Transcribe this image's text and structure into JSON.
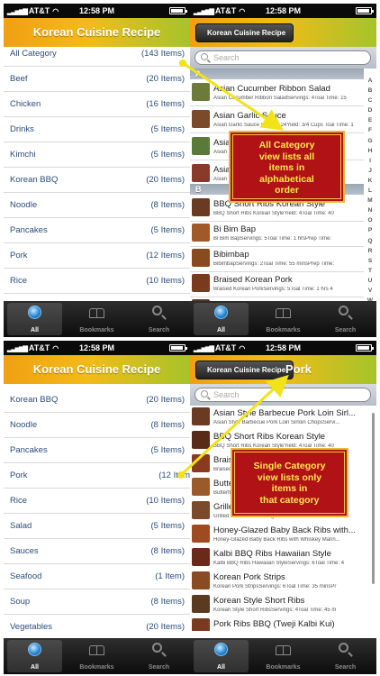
{
  "status": {
    "carrier": "AT&T",
    "time": "12:58 PM"
  },
  "app_title": "Korean Cuisine Recipe",
  "back_label": "Korean Cuisine Recipe",
  "search_placeholder": "Search",
  "tabs": [
    {
      "label": "All",
      "icon": "globe-icon"
    },
    {
      "label": "Bookmarks",
      "icon": "book-icon"
    },
    {
      "label": "Search",
      "icon": "magnifier-icon"
    }
  ],
  "categories_top": [
    {
      "name": "All Category",
      "count": "(143 Items)"
    },
    {
      "name": "Beef",
      "count": "(20 Items)"
    },
    {
      "name": "Chicken",
      "count": "(16 Items)"
    },
    {
      "name": "Drinks",
      "count": "(5 Items)"
    },
    {
      "name": "Kimchi",
      "count": "(5 Items)"
    },
    {
      "name": "Korean BBQ",
      "count": "(20 Items)"
    },
    {
      "name": "Noodle",
      "count": "(8 Items)"
    },
    {
      "name": "Pancakes",
      "count": "(5 Items)"
    },
    {
      "name": "Pork",
      "count": "(12 Items)"
    },
    {
      "name": "Rice",
      "count": "(10 Items)"
    }
  ],
  "categories_bottom": [
    {
      "name": "Korean BBQ",
      "count": "(20 Items)"
    },
    {
      "name": "Noodle",
      "count": "(8 Items)"
    },
    {
      "name": "Pancakes",
      "count": "(5 Items)"
    },
    {
      "name": "Pork",
      "count": "(12 Items)"
    },
    {
      "name": "Rice",
      "count": "(10 Items)"
    },
    {
      "name": "Salad",
      "count": "(5 Items)"
    },
    {
      "name": "Sauces",
      "count": "(8 Items)"
    },
    {
      "name": "Seafood",
      "count": "(1 Item)"
    },
    {
      "name": "Soup",
      "count": "(8 Items)"
    },
    {
      "name": "Vegetables",
      "count": "(20 Items)"
    }
  ],
  "all_recipes": {
    "section_a": "A",
    "section_a_items": [
      {
        "title": "Asian Cucumber Ribbon Salad",
        "sub": "Asian Cucumber Ribbon SaladServings: 4Toal Time: 15",
        "color": "#6d7b3a"
      },
      {
        "title": "Asian Garlic Sauce",
        "sub": "Asian Garlic Sauce Serves: 24Yield: 3/4 Cups Toal Time: 1",
        "color": "#7a4a2a"
      },
      {
        "title": "Asian Cucumber",
        "sub": "Asian",
        "color": "#5a7a3a"
      },
      {
        "title": "Asian Pork",
        "sub": "Asian",
        "color": "#8a3a2a"
      }
    ],
    "section_b": "B",
    "section_b_items": [
      {
        "title": "BBQ Short Ribs Korean Style",
        "sub": "BBQ Short Ribs Korean StyleYield: 4Toal Time: 40",
        "color": "#6a3a22"
      },
      {
        "title": "Bi Bim Bap",
        "sub": "Bi Bim BapServings: 5Toal Time: 1 hrsPrep Time:",
        "color": "#a05a2a"
      },
      {
        "title": "Bibimbap",
        "sub": "BibimbapServings: 2Toal Time: 55 minsPrep Time:",
        "color": "#8a4a20"
      },
      {
        "title": "Braised Korean Pork",
        "sub": "Braised Korean PorkServings: 5Toal Time: 1 hrs 4",
        "color": "#7a3a1e"
      },
      {
        "title": "Braised Short Ribs with Daikon and",
        "sub": "",
        "color": "#5a3a24"
      }
    ],
    "index_letters": [
      "A",
      "B",
      "C",
      "D",
      "E",
      "F",
      "G",
      "H",
      "I",
      "J",
      "K",
      "L",
      "M",
      "N",
      "O",
      "P",
      "Q",
      "R",
      "S",
      "T",
      "U",
      "V",
      "W",
      "X",
      "Y",
      "Z"
    ]
  },
  "pork_page": {
    "title": "Pork",
    "items": [
      {
        "title": "Asian Style Barbecue Pork Loin Sirl...",
        "sub": "Asian Style Barbecue Pork Loin Sirloin ChopsServi...",
        "color": "#6a3a22"
      },
      {
        "title": "BBQ Short Ribs Korean Style",
        "sub": "BBQ Short Ribs Korean StyleYield: 4Toal Time: 40",
        "color": "#5a2a18"
      },
      {
        "title": "Braised Korean Pork",
        "sub": "Braised Korean PorkServings: 5",
        "color": "#8a3a1e"
      },
      {
        "title": "Butterflied Pork Chops",
        "sub": "Butterflied",
        "color": "#9a5a2a"
      },
      {
        "title": "Grilled Short Ribs",
        "sub": "Grilled Short RibsServings: 8Toal Time: 1 hrs 40",
        "color": "#7a4a2a"
      },
      {
        "title": "Honey-Glazed Baby Back Ribs with...",
        "sub": "Honey-Glazed Baby Back Ribs with Whiskey Marin...",
        "color": "#a04a22"
      },
      {
        "title": "Kalbi BBQ Ribs Hawaiian Style",
        "sub": "Kalbi BBQ Ribs Hawaiian StyleServings: 6Toal Time: 4",
        "color": "#6a2a1a"
      },
      {
        "title": "Korean Pork Strips",
        "sub": "Korean Pork StripsServings: 6Toal Time: 35 minsPr",
        "color": "#8a4a22"
      },
      {
        "title": "Korean Style Short Ribs",
        "sub": "Korean Style Short RibsServings: 4Toal Time: 45 m",
        "color": "#5a3a20"
      },
      {
        "title": "Pork Ribs BBQ (Tweji Kalbi Kui)",
        "sub": "",
        "color": "#7a3a20"
      }
    ]
  },
  "callout_all": [
    "All Category",
    "view lists all",
    "items in",
    "alphabetical",
    "order"
  ],
  "callout_single": [
    "Single Category",
    "view lists only",
    "items in",
    "that category"
  ],
  "colors": {
    "accent_orange": "#f0a012",
    "accent_green": "#a6c42a",
    "callout_red": "#b01216",
    "callout_text": "#ffe84a",
    "arrow": "#f2e21a"
  }
}
